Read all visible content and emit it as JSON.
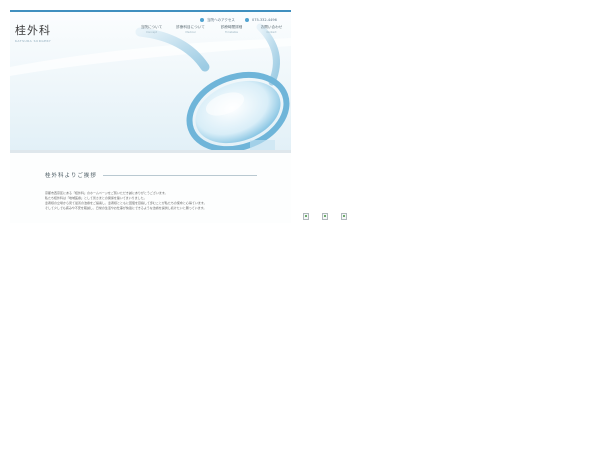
{
  "header": {
    "logo": "桂外科",
    "logo_sub": "KATSURA SURGERY",
    "access": "当院へのアクセス",
    "phone": "075-332-4496"
  },
  "nav": [
    {
      "label": "当院について",
      "sub": "Concept"
    },
    {
      "label": "診療科目について",
      "sub": "Medical"
    },
    {
      "label": "診療時間詳細",
      "sub": "Timetable"
    },
    {
      "label": "お問い合わせ",
      "sub": "Contact"
    }
  ],
  "greeting": {
    "title": "桂外科よりご挨拶",
    "lines": [
      "京都市西京区にある「桂外科」のホームページをご覧いただき誠にありがとうございます。",
      "私たち桂外科は「地域医療」として皆さまとの関係を築いてまいりました。",
      "患者様の立場から見て最善の治療をご提案し、患者様とともに回復を目指して歩むことが私たちの使命と心得ています。",
      "そして少しでも痛みや不安を軽減し、日常の生活やお仕事が快適にできるような治療を提供し続けたいと願っています。"
    ]
  },
  "bottom_icons": [
    "broken-image-icon",
    "broken-image-icon",
    "broken-image-icon"
  ]
}
